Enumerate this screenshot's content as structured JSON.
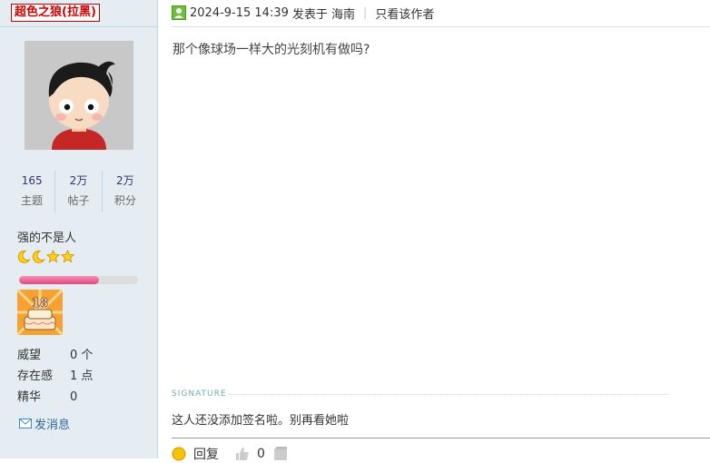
{
  "author": {
    "username": "超色之狼(拉黑)",
    "stats": [
      {
        "value": "165",
        "label": "主题"
      },
      {
        "value": "2万",
        "label": "帖子"
      },
      {
        "value": "2万",
        "label": "积分"
      }
    ],
    "rank_title": "强的不是人",
    "rank_icons": [
      "moon-icon",
      "moon-icon",
      "star-icon",
      "star-icon"
    ],
    "level_progress_fraction": 0.67,
    "medal_icon": "birthday-cake-18-medal",
    "info": [
      {
        "key": "威望",
        "value": "0 个"
      },
      {
        "key": "存在感",
        "value": "1 点"
      },
      {
        "key": "精华",
        "value": "0"
      }
    ],
    "send_message": "发消息"
  },
  "post": {
    "online_icon": "user-online-icon",
    "timestamp": "2024-9-15 14:39",
    "posted_in_text": "发表于 海南",
    "only_author": "只看该作者",
    "content": "那个像球场一样大的光刻机有做吗?",
    "signature_label": "SIGNATURE",
    "signature_text": "这人还没添加签名啦。别再看她啦",
    "reply_label": "回复",
    "like_count": "0"
  },
  "colors": {
    "sidebar_bg": "#e5edf2",
    "username_red": "#cc0000",
    "link_blue": "#336699",
    "progress_pink": "#e2487f"
  }
}
